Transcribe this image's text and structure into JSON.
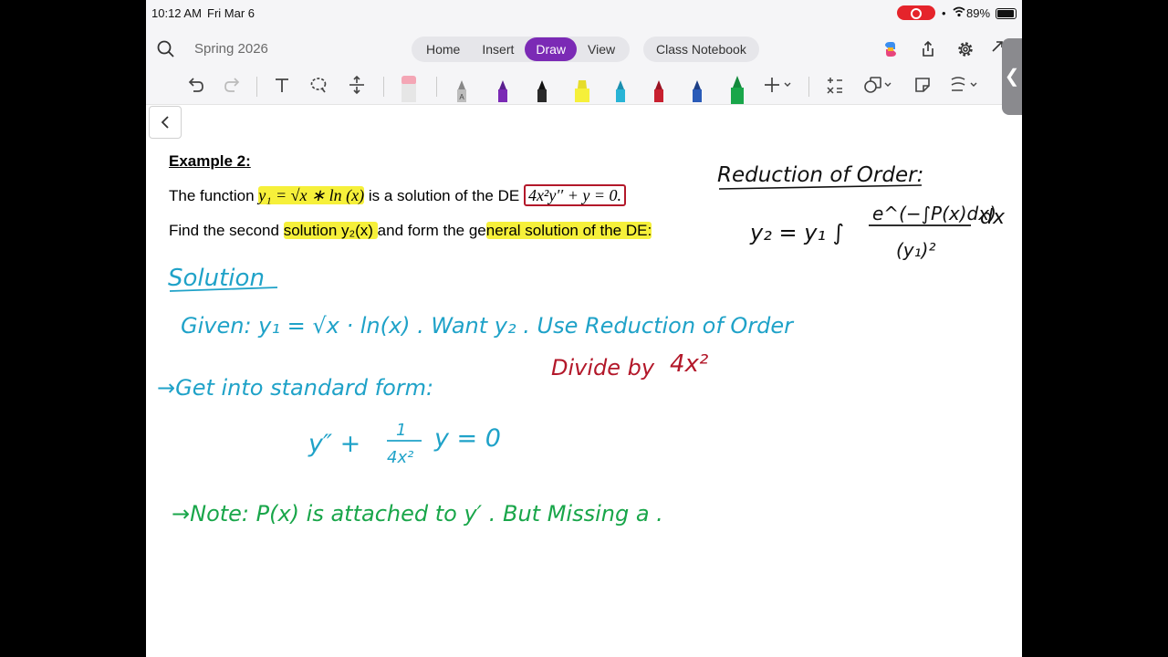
{
  "status_bar": {
    "time": "10:12 AM",
    "date": "Fri Mar 6",
    "battery": "89%"
  },
  "header": {
    "notebook_name": "Spring 2026",
    "tabs": [
      {
        "label": "Home"
      },
      {
        "label": "Insert"
      },
      {
        "label": "Draw",
        "active": true
      },
      {
        "label": "View"
      }
    ],
    "class_notebook": "Class Notebook"
  },
  "colors": {
    "accent": "#7b2ab5",
    "highlight": "#f6f03a",
    "ink_blue": "#1fa2c8",
    "ink_red": "#b3182a",
    "ink_green": "#19a64a",
    "ink_black": "#111111"
  },
  "page": {
    "example_title": "Example 2:",
    "line1": {
      "prefix": "The function ",
      "y1_expr": "y₁ = √x ∗ ln (x)",
      "middle": " is a solution of the DE ",
      "de_expr": "4x²y′′ + y = 0."
    },
    "line2": {
      "prefix": "Find the second ",
      "hl1": "solution y₂(x) ",
      "middle": "and form the ge",
      "hl2": "neral solution of the DE:"
    }
  },
  "handwriting": {
    "reduction_title": "Reduction of Order:",
    "formula_lhs": "y₂ = y₁ ∫",
    "formula_num": "e^(−∫P(x)dx)",
    "formula_den": "(y₁)²",
    "formula_dx": "dx",
    "solution_label": "Solution",
    "given_line": "Given: y₁ = √x · ln(x) . Want y₂ . Use Reduction of Order",
    "standard_form": "→Get into standard form:",
    "divide_by": "Divide by",
    "divide_expr": "4x²",
    "equation_lhs": "y″ +",
    "equation_frac_num": "1",
    "equation_frac_den": "4x²",
    "equation_rhs": "y = 0",
    "note_line": "→Note: P(x) is attached to y′ . But Missing a ."
  }
}
